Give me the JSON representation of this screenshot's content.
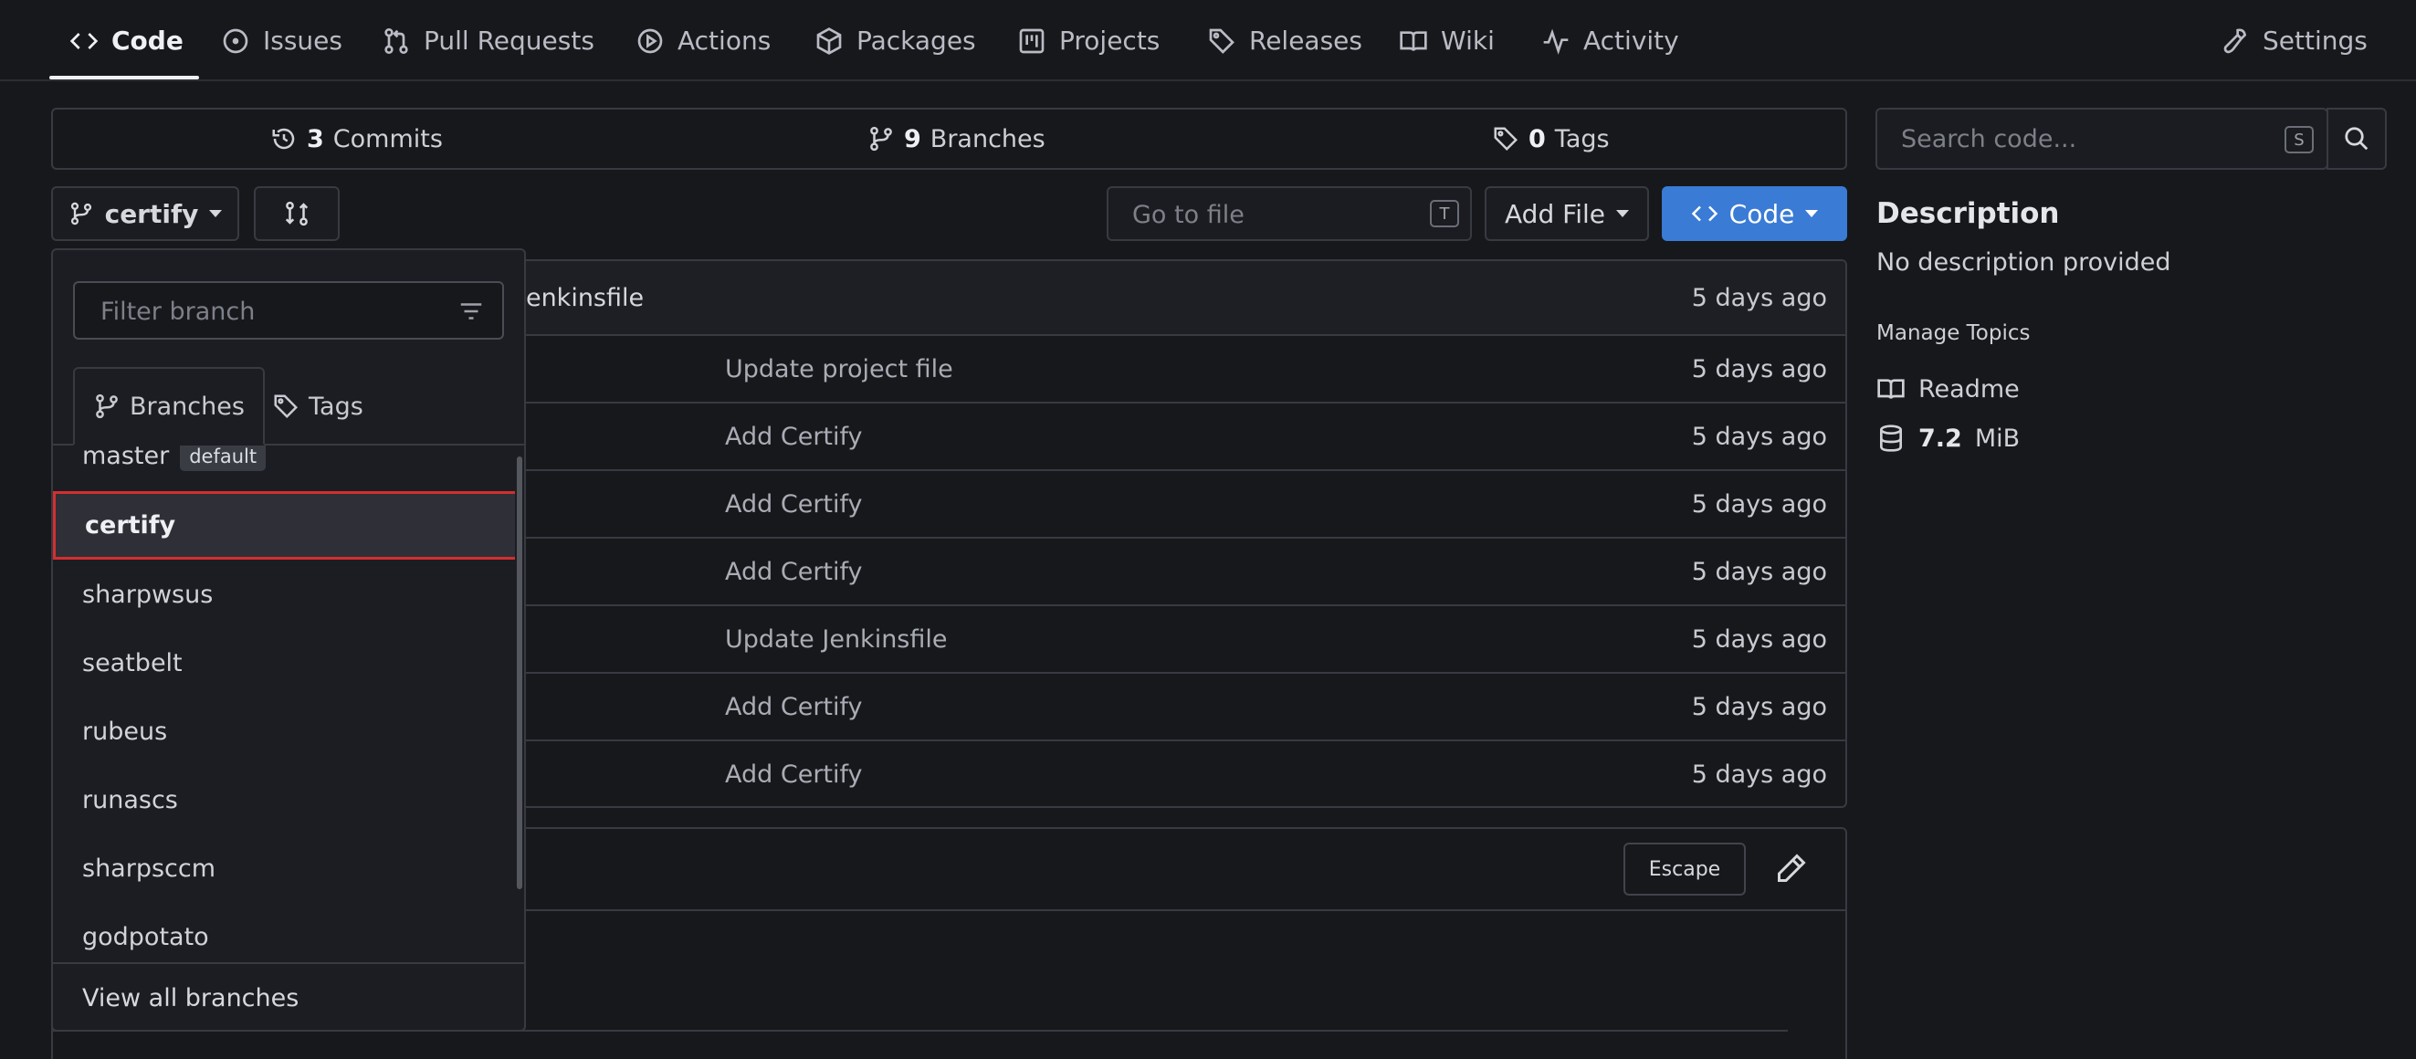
{
  "nav": {
    "code": "Code",
    "issues": "Issues",
    "pull_requests": "Pull Requests",
    "actions": "Actions",
    "packages": "Packages",
    "projects": "Projects",
    "releases": "Releases",
    "wiki": "Wiki",
    "activity": "Activity",
    "settings": "Settings"
  },
  "summary": {
    "commits_count": "3",
    "commits_label": "Commits",
    "branches_count": "9",
    "branches_label": "Branches",
    "tags_count": "0",
    "tags_label": "Tags"
  },
  "toolbar": {
    "branch_name": "certify",
    "goto_placeholder": "Go to file",
    "goto_shortcut": "T",
    "add_file": "Add File",
    "code": "Code"
  },
  "files": {
    "head_commit": "Jenkinsfile",
    "head_age": "5 days ago",
    "rows": [
      {
        "message": "Update project file",
        "age": "5 days ago"
      },
      {
        "message": "Add Certify",
        "age": "5 days ago"
      },
      {
        "message": "Add Certify",
        "age": "5 days ago"
      },
      {
        "message": "Add Certify",
        "age": "5 days ago"
      },
      {
        "message": "Update Jenkinsfile",
        "age": "5 days ago"
      },
      {
        "message": "Add Certify",
        "age": "5 days ago"
      },
      {
        "message": "Add Certify",
        "age": "5 days ago"
      }
    ]
  },
  "readme": {
    "escape": "Escape"
  },
  "sidebar": {
    "search_placeholder": "Search code...",
    "search_shortcut": "S",
    "description_title": "Description",
    "description_text": "No description provided",
    "manage_topics": "Manage Topics",
    "readme": "Readme",
    "size_value": "7.2",
    "size_unit": "MiB"
  },
  "dropdown": {
    "filter_placeholder": "Filter branch",
    "tab_branches": "Branches",
    "tab_tags": "Tags",
    "branches": [
      {
        "name": "master",
        "badge": "default"
      },
      {
        "name": "certify"
      },
      {
        "name": "sharpwsus"
      },
      {
        "name": "seatbelt"
      },
      {
        "name": "rubeus"
      },
      {
        "name": "runascs"
      },
      {
        "name": "sharpsccm"
      },
      {
        "name": "godpotato"
      }
    ],
    "view_all": "View all branches"
  },
  "colors": {
    "background": "#17181c",
    "primary": "#3a7bd5",
    "highlight_border": "#d32f2f"
  }
}
